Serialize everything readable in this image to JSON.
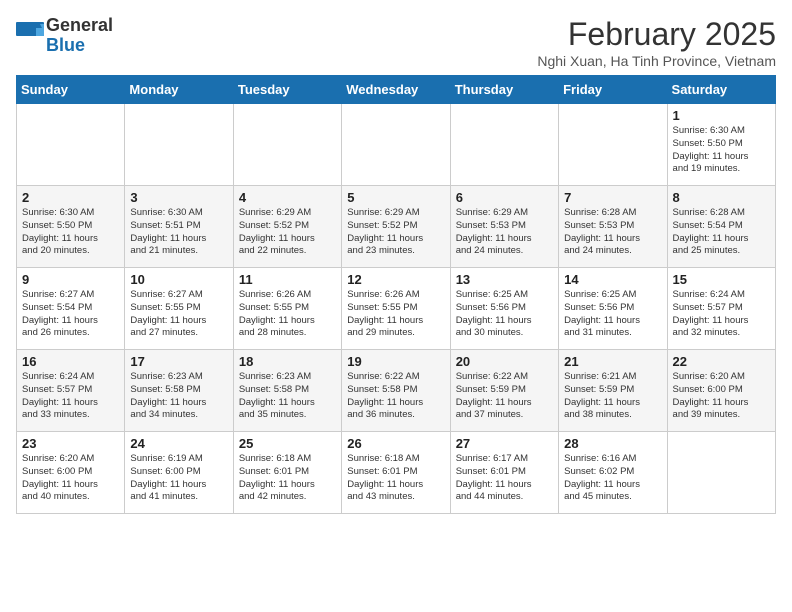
{
  "header": {
    "logo_line1": "General",
    "logo_line2": "Blue",
    "title": "February 2025",
    "subtitle": "Nghi Xuan, Ha Tinh Province, Vietnam"
  },
  "days_of_week": [
    "Sunday",
    "Monday",
    "Tuesday",
    "Wednesday",
    "Thursday",
    "Friday",
    "Saturday"
  ],
  "weeks": [
    [
      {
        "day": "",
        "info": ""
      },
      {
        "day": "",
        "info": ""
      },
      {
        "day": "",
        "info": ""
      },
      {
        "day": "",
        "info": ""
      },
      {
        "day": "",
        "info": ""
      },
      {
        "day": "",
        "info": ""
      },
      {
        "day": "1",
        "info": "Sunrise: 6:30 AM\nSunset: 5:50 PM\nDaylight: 11 hours\nand 19 minutes."
      }
    ],
    [
      {
        "day": "2",
        "info": "Sunrise: 6:30 AM\nSunset: 5:50 PM\nDaylight: 11 hours\nand 20 minutes."
      },
      {
        "day": "3",
        "info": "Sunrise: 6:30 AM\nSunset: 5:51 PM\nDaylight: 11 hours\nand 21 minutes."
      },
      {
        "day": "4",
        "info": "Sunrise: 6:29 AM\nSunset: 5:52 PM\nDaylight: 11 hours\nand 22 minutes."
      },
      {
        "day": "5",
        "info": "Sunrise: 6:29 AM\nSunset: 5:52 PM\nDaylight: 11 hours\nand 23 minutes."
      },
      {
        "day": "6",
        "info": "Sunrise: 6:29 AM\nSunset: 5:53 PM\nDaylight: 11 hours\nand 24 minutes."
      },
      {
        "day": "7",
        "info": "Sunrise: 6:28 AM\nSunset: 5:53 PM\nDaylight: 11 hours\nand 24 minutes."
      },
      {
        "day": "8",
        "info": "Sunrise: 6:28 AM\nSunset: 5:54 PM\nDaylight: 11 hours\nand 25 minutes."
      }
    ],
    [
      {
        "day": "9",
        "info": "Sunrise: 6:27 AM\nSunset: 5:54 PM\nDaylight: 11 hours\nand 26 minutes."
      },
      {
        "day": "10",
        "info": "Sunrise: 6:27 AM\nSunset: 5:55 PM\nDaylight: 11 hours\nand 27 minutes."
      },
      {
        "day": "11",
        "info": "Sunrise: 6:26 AM\nSunset: 5:55 PM\nDaylight: 11 hours\nand 28 minutes."
      },
      {
        "day": "12",
        "info": "Sunrise: 6:26 AM\nSunset: 5:55 PM\nDaylight: 11 hours\nand 29 minutes."
      },
      {
        "day": "13",
        "info": "Sunrise: 6:25 AM\nSunset: 5:56 PM\nDaylight: 11 hours\nand 30 minutes."
      },
      {
        "day": "14",
        "info": "Sunrise: 6:25 AM\nSunset: 5:56 PM\nDaylight: 11 hours\nand 31 minutes."
      },
      {
        "day": "15",
        "info": "Sunrise: 6:24 AM\nSunset: 5:57 PM\nDaylight: 11 hours\nand 32 minutes."
      }
    ],
    [
      {
        "day": "16",
        "info": "Sunrise: 6:24 AM\nSunset: 5:57 PM\nDaylight: 11 hours\nand 33 minutes."
      },
      {
        "day": "17",
        "info": "Sunrise: 6:23 AM\nSunset: 5:58 PM\nDaylight: 11 hours\nand 34 minutes."
      },
      {
        "day": "18",
        "info": "Sunrise: 6:23 AM\nSunset: 5:58 PM\nDaylight: 11 hours\nand 35 minutes."
      },
      {
        "day": "19",
        "info": "Sunrise: 6:22 AM\nSunset: 5:58 PM\nDaylight: 11 hours\nand 36 minutes."
      },
      {
        "day": "20",
        "info": "Sunrise: 6:22 AM\nSunset: 5:59 PM\nDaylight: 11 hours\nand 37 minutes."
      },
      {
        "day": "21",
        "info": "Sunrise: 6:21 AM\nSunset: 5:59 PM\nDaylight: 11 hours\nand 38 minutes."
      },
      {
        "day": "22",
        "info": "Sunrise: 6:20 AM\nSunset: 6:00 PM\nDaylight: 11 hours\nand 39 minutes."
      }
    ],
    [
      {
        "day": "23",
        "info": "Sunrise: 6:20 AM\nSunset: 6:00 PM\nDaylight: 11 hours\nand 40 minutes."
      },
      {
        "day": "24",
        "info": "Sunrise: 6:19 AM\nSunset: 6:00 PM\nDaylight: 11 hours\nand 41 minutes."
      },
      {
        "day": "25",
        "info": "Sunrise: 6:18 AM\nSunset: 6:01 PM\nDaylight: 11 hours\nand 42 minutes."
      },
      {
        "day": "26",
        "info": "Sunrise: 6:18 AM\nSunset: 6:01 PM\nDaylight: 11 hours\nand 43 minutes."
      },
      {
        "day": "27",
        "info": "Sunrise: 6:17 AM\nSunset: 6:01 PM\nDaylight: 11 hours\nand 44 minutes."
      },
      {
        "day": "28",
        "info": "Sunrise: 6:16 AM\nSunset: 6:02 PM\nDaylight: 11 hours\nand 45 minutes."
      },
      {
        "day": "",
        "info": ""
      }
    ]
  ]
}
